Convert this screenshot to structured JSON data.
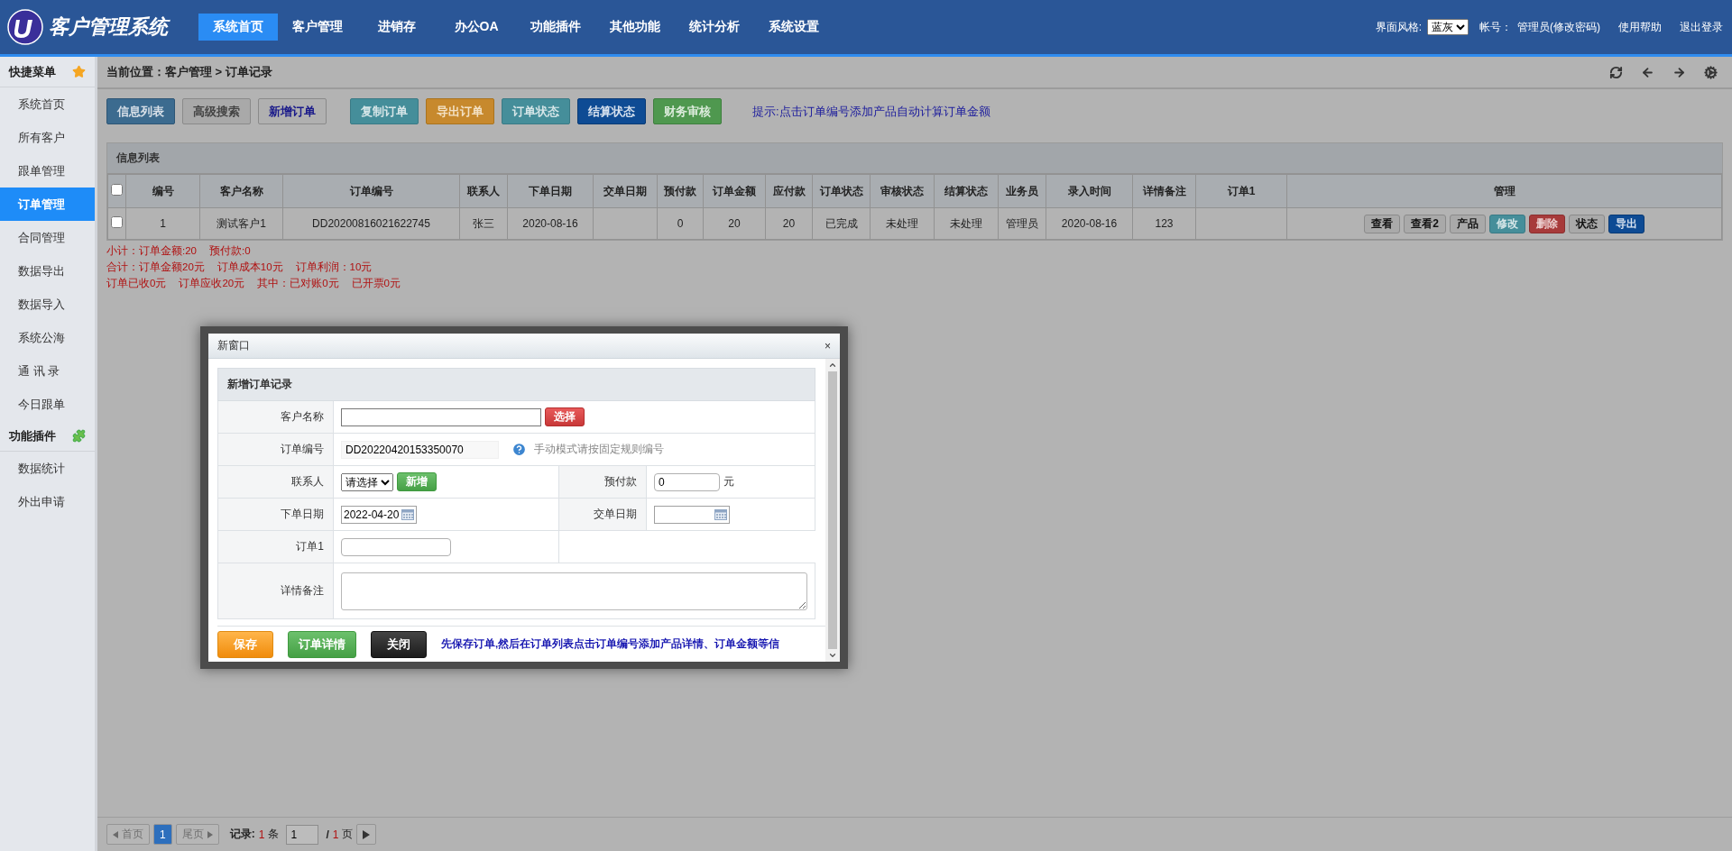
{
  "header": {
    "logo_text": "客户管理系统",
    "nav": [
      {
        "label": "系统首页",
        "selected": true
      },
      {
        "label": "客户管理",
        "selected": false
      },
      {
        "label": "进销存",
        "selected": false
      },
      {
        "label": "办公OA",
        "selected": false
      },
      {
        "label": "功能插件",
        "selected": false
      },
      {
        "label": "其他功能",
        "selected": false
      },
      {
        "label": "统计分析",
        "selected": false
      },
      {
        "label": "系统设置",
        "selected": false
      }
    ],
    "theme_label": "界面风格:",
    "theme_value": "蓝灰",
    "account_label": "帐号：",
    "account_value": "管理员(修改密码)",
    "links": [
      "使用帮助",
      "退出登录"
    ]
  },
  "sidebar": [
    {
      "title": "快捷菜单",
      "kind": "star",
      "items": [
        {
          "label": "系统首页",
          "selected": false
        },
        {
          "label": "所有客户",
          "selected": false
        },
        {
          "label": "跟单管理",
          "selected": false
        },
        {
          "label": "订单管理",
          "selected": true
        },
        {
          "label": "合同管理",
          "selected": false
        },
        {
          "label": "数据导出",
          "selected": false
        },
        {
          "label": "数据导入",
          "selected": false
        },
        {
          "label": "系统公海",
          "selected": false
        },
        {
          "label": "通 讯 录",
          "selected": false
        },
        {
          "label": "今日跟单",
          "selected": false
        }
      ]
    },
    {
      "title": "功能插件",
      "kind": "puzzle",
      "items": [
        {
          "label": "数据统计",
          "selected": false
        },
        {
          "label": "外出申请",
          "selected": false
        }
      ]
    }
  ],
  "breadcrumb": "当前位置：客户管理 > 订单记录",
  "toolbar": {
    "groups": [
      [
        {
          "label": "信息列表",
          "kind": "primary"
        },
        {
          "label": "高级搜索",
          "kind": "default"
        },
        {
          "label": "新增订单",
          "kind": "plain"
        }
      ],
      [
        {
          "label": "复制订单",
          "kind": "info"
        },
        {
          "label": "导出订单",
          "kind": "warning"
        },
        {
          "label": "订单状态",
          "kind": "info"
        },
        {
          "label": "结算状态",
          "kind": "navy"
        },
        {
          "label": "财务审核",
          "kind": "success"
        }
      ]
    ],
    "hint": "提示:点击订单编号添加产品自动计算订单金额"
  },
  "table": {
    "title": "信息列表",
    "select_all": {
      "checked": false
    },
    "columns": [
      "编号",
      "客户名称",
      "订单编号",
      "联系人",
      "下单日期",
      "交单日期",
      "预付款",
      "订单金额",
      "应付款",
      "订单状态",
      "审核状态",
      "结算状态",
      "业务员",
      "录入时间",
      "详情备注",
      "订单1",
      "管理"
    ],
    "rows": [
      {
        "checked": false,
        "cells": [
          "1",
          "测试客户1",
          "DD20200816021622745",
          "张三",
          "2020-08-16",
          "",
          "0",
          "20",
          "20",
          "已完成",
          "未处理",
          "未处理",
          "管理员",
          "2020-08-16",
          "123",
          ""
        ],
        "actions": [
          {
            "label": "查看",
            "kind": "default"
          },
          {
            "label": "查看2",
            "kind": "default"
          },
          {
            "label": "产品",
            "kind": "default"
          },
          {
            "label": "修改",
            "kind": "info"
          },
          {
            "label": "删除",
            "kind": "danger"
          },
          {
            "label": "状态",
            "kind": "default"
          },
          {
            "label": "导出",
            "kind": "navy"
          }
        ]
      }
    ]
  },
  "summary": [
    [
      "小计：订单金额:20",
      "预付款:0"
    ],
    [
      "合计：订单金额20元",
      "订单成本10元",
      "订单利润：10元"
    ],
    [
      "订单已收0元",
      "订单应收20元",
      "其中：已对账0元",
      "已开票0元"
    ]
  ],
  "dialog": {
    "title": "新窗口",
    "close": "×",
    "form_title": "新增订单记录",
    "rows": [
      [
        {
          "label": "客户名称",
          "kind": "picker",
          "button": "选择"
        }
      ],
      [
        {
          "label": "订单编号",
          "kind": "readonly",
          "value": "DD20220420153350070",
          "hint": "手动模式请按固定规则编号"
        }
      ],
      [
        {
          "label": "联系人",
          "kind": "select",
          "value": "请选择",
          "button": "新增"
        },
        {
          "label": "预付款",
          "kind": "text",
          "value": "0",
          "unit": "元"
        }
      ],
      [
        {
          "label": "下单日期",
          "kind": "date",
          "value": "2022-04-20"
        },
        {
          "label": "交单日期",
          "kind": "date"
        }
      ],
      [
        {
          "label": "订单1",
          "kind": "text"
        }
      ],
      [
        {
          "label": "详情备注",
          "kind": "textarea"
        }
      ]
    ],
    "buttons": [
      {
        "label": "保存",
        "kind": "warning"
      },
      {
        "label": "订单详情",
        "kind": "success"
      },
      {
        "label": "关闭",
        "kind": "dark"
      }
    ],
    "note": "先保存订单,然后在订单列表点击订单编号添加产品详情、订单金额等信"
  },
  "pager": {
    "first": "首页",
    "first_disabled": true,
    "pages": [
      {
        "label": "1",
        "selected": true
      }
    ],
    "last": "尾页",
    "last_disabled": true,
    "record_label": "记录:",
    "record_count": "1",
    "record_unit": "条",
    "page_value": "1",
    "separator": "/",
    "page_total": "1",
    "page_unit": "页"
  }
}
